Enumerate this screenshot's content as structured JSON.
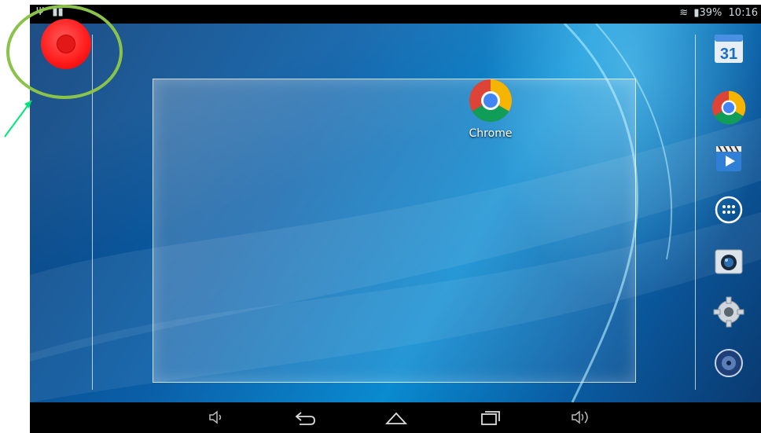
{
  "statusbar": {
    "battery_text": "39%",
    "time": "10:16",
    "icons": [
      "usb-icon",
      "barcode-icon",
      "wifi-icon",
      "battery-icon"
    ]
  },
  "home": {
    "apps": [
      {
        "label": "Chrome",
        "icon": "chrome-icon"
      }
    ]
  },
  "dock": {
    "items": [
      {
        "icon": "calendar-icon",
        "text": "31"
      },
      {
        "icon": "chrome-icon"
      },
      {
        "icon": "play-movies-icon"
      },
      {
        "icon": "app-drawer-icon"
      },
      {
        "icon": "camera-icon"
      },
      {
        "icon": "settings-icon"
      },
      {
        "icon": "music-icon"
      }
    ]
  },
  "navbar": {
    "icons": [
      "volume-down-icon",
      "back-icon",
      "home-icon",
      "recents-icon",
      "volume-up-icon"
    ]
  },
  "overlay": {
    "floating_button": "red-record-button",
    "highlight_color": "#8bc34a",
    "arrow_color": "#00e676"
  }
}
